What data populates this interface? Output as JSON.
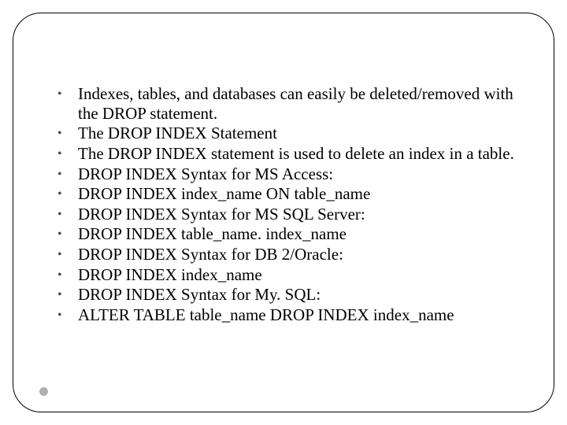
{
  "bullets": {
    "b0": "Indexes, tables, and databases can easily be deleted/removed with the DROP statement.",
    "b1": "The DROP INDEX Statement",
    "b2": "The DROP INDEX statement is used to delete an index in a table.",
    "b3": "DROP INDEX Syntax for MS Access:",
    "b4": "DROP INDEX index_name ON table_name",
    "b5": "DROP INDEX Syntax for MS SQL Server:",
    "b6": "DROP INDEX table_name. index_name",
    "b7": "DROP INDEX Syntax for DB 2/Oracle:",
    "b8": "DROP INDEX index_name",
    "b9": "DROP INDEX Syntax for My. SQL:",
    "b10": "ALTER TABLE table_name DROP INDEX index_name"
  },
  "marker": "•"
}
